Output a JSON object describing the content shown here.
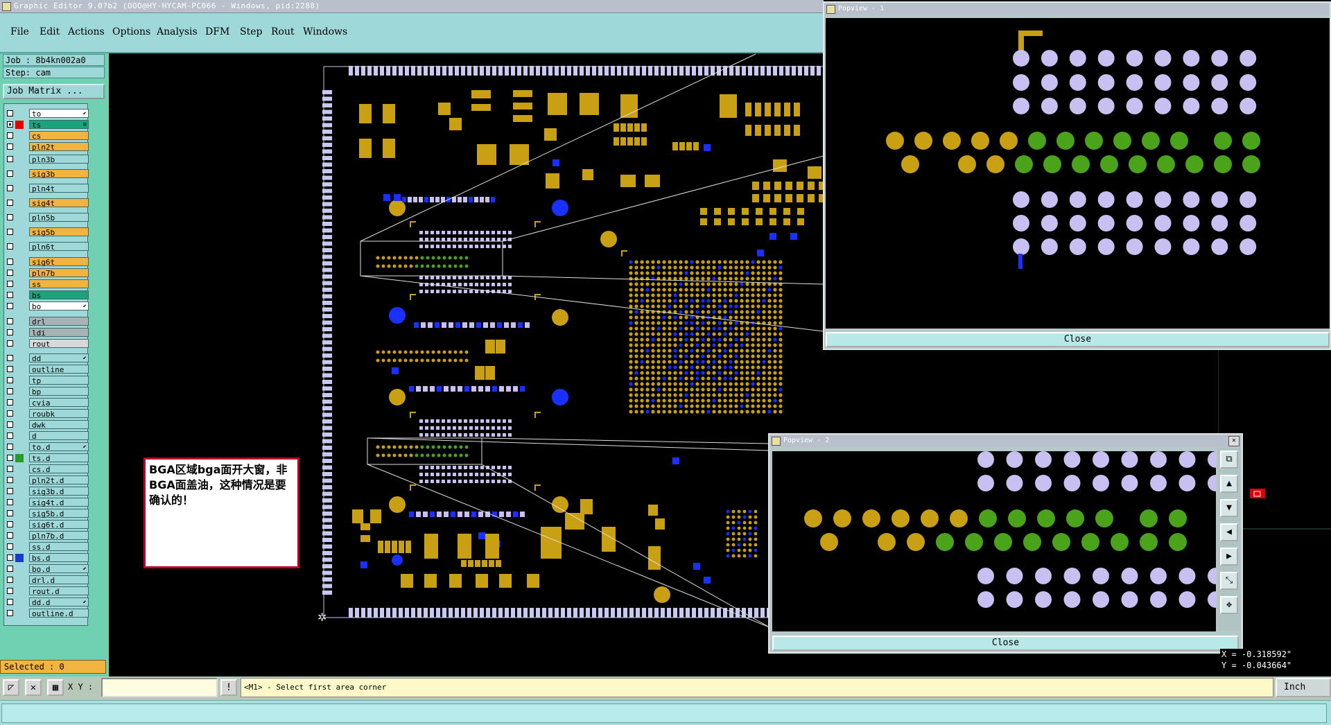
{
  "app": {
    "title": "Graphic Editor 9.0?b2 (OOO@HY-HYCAM-PC066 - Windows, pid:2288)"
  },
  "menu": [
    "File",
    "Edit",
    "Actions",
    "Options",
    "Analysis",
    "DFM",
    "Step",
    "Rout",
    "Windows"
  ],
  "job": {
    "job_line": "Job : 8b4kn002a0",
    "step_line": "Step: cam",
    "matrix_label": "Job Matrix ..."
  },
  "layers": [
    {
      "name": "to",
      "color": "#ffffff",
      "swatch": "",
      "mark": "⬋",
      "checked": false
    },
    {
      "name": "ts",
      "color": "#1aa37a",
      "swatch": "#e00000",
      "mark": "≡",
      "checked": true
    },
    {
      "name": "cs",
      "color": "#f2b441",
      "swatch": "",
      "mark": "",
      "checked": false
    },
    {
      "name": "pln2t",
      "color": "#f2b441",
      "swatch": "",
      "mark": "",
      "checked": false
    },
    {
      "name": "pln3b",
      "color": "#9fd8d8",
      "swatch": "",
      "mark": "",
      "checked": false
    },
    {
      "name": "sig3b",
      "color": "#f2b441",
      "swatch": "",
      "mark": "",
      "checked": false
    },
    {
      "name": "pln4t",
      "color": "#9fd8d8",
      "swatch": "",
      "mark": "",
      "checked": false
    },
    {
      "name": "sig4t",
      "color": "#f2b441",
      "swatch": "",
      "mark": "",
      "checked": false
    },
    {
      "name": "pln5b",
      "color": "#9fd8d8",
      "swatch": "",
      "mark": "",
      "checked": false
    },
    {
      "name": "sig5b",
      "color": "#f2b441",
      "swatch": "",
      "mark": "",
      "checked": false
    },
    {
      "name": "pln6t",
      "color": "#9fd8d8",
      "swatch": "",
      "mark": "",
      "checked": false
    },
    {
      "name": "sig6t",
      "color": "#f2b441",
      "swatch": "",
      "mark": "",
      "checked": false
    },
    {
      "name": "pln7b",
      "color": "#f2b441",
      "swatch": "",
      "mark": "",
      "checked": false
    },
    {
      "name": "ss",
      "color": "#f2b441",
      "swatch": "",
      "mark": "",
      "checked": false
    },
    {
      "name": "bs",
      "color": "#1aa37a",
      "swatch": "",
      "mark": "",
      "checked": false
    },
    {
      "name": "bo",
      "color": "#ffffff",
      "swatch": "",
      "mark": "⬋",
      "checked": false
    },
    {
      "name": "drl",
      "color": "#a8b4b4",
      "swatch": "",
      "mark": "",
      "checked": false
    },
    {
      "name": "ldi",
      "color": "#a8b4b4",
      "swatch": "",
      "mark": "",
      "checked": false
    },
    {
      "name": "rout",
      "color": "#d8d8d8",
      "swatch": "",
      "mark": "",
      "checked": false
    },
    {
      "name": "dd",
      "color": "#9fd8d8",
      "swatch": "",
      "mark": "⬋",
      "checked": false
    },
    {
      "name": "outline",
      "color": "#9fd8d8",
      "swatch": "",
      "mark": "",
      "checked": false
    },
    {
      "name": "tp",
      "color": "#9fd8d8",
      "swatch": "",
      "mark": "",
      "checked": false
    },
    {
      "name": "bp",
      "color": "#9fd8d8",
      "swatch": "",
      "mark": "",
      "checked": false
    },
    {
      "name": "cvia",
      "color": "#9fd8d8",
      "swatch": "",
      "mark": "",
      "checked": false
    },
    {
      "name": "roubk",
      "color": "#9fd8d8",
      "swatch": "",
      "mark": "",
      "checked": false
    },
    {
      "name": "dwk",
      "color": "#9fd8d8",
      "swatch": "",
      "mark": "",
      "checked": false
    },
    {
      "name": "d",
      "color": "#9fd8d8",
      "swatch": "",
      "mark": "",
      "checked": false
    },
    {
      "name": "to.d",
      "color": "#9fd8d8",
      "swatch": "",
      "mark": "⬋",
      "checked": false
    },
    {
      "name": "ts.d",
      "color": "#9fd8d8",
      "swatch": "#2a9a2a",
      "mark": "",
      "checked": false
    },
    {
      "name": "cs.d",
      "color": "#9fd8d8",
      "swatch": "",
      "mark": "",
      "checked": false
    },
    {
      "name": "pln2t.d",
      "color": "#9fd8d8",
      "swatch": "",
      "mark": "",
      "checked": false
    },
    {
      "name": "sig3b.d",
      "color": "#9fd8d8",
      "swatch": "",
      "mark": "",
      "checked": false
    },
    {
      "name": "sig4t.d",
      "color": "#9fd8d8",
      "swatch": "",
      "mark": "",
      "checked": false
    },
    {
      "name": "sig5b.d",
      "color": "#9fd8d8",
      "swatch": "",
      "mark": "",
      "checked": false
    },
    {
      "name": "sig6t.d",
      "color": "#9fd8d8",
      "swatch": "",
      "mark": "",
      "checked": false
    },
    {
      "name": "pln7b.d",
      "color": "#9fd8d8",
      "swatch": "",
      "mark": "",
      "checked": false
    },
    {
      "name": "ss.d",
      "color": "#9fd8d8",
      "swatch": "",
      "mark": "",
      "checked": false
    },
    {
      "name": "bs.d",
      "color": "#9fd8d8",
      "swatch": "#1a3ad0",
      "mark": "",
      "checked": false
    },
    {
      "name": "bo.d",
      "color": "#9fd8d8",
      "swatch": "",
      "mark": "⬋",
      "checked": false
    },
    {
      "name": "drl.d",
      "color": "#9fd8d8",
      "swatch": "",
      "mark": "",
      "checked": false
    },
    {
      "name": "rout.d",
      "color": "#9fd8d8",
      "swatch": "",
      "mark": "",
      "checked": false
    },
    {
      "name": "dd.d",
      "color": "#9fd8d8",
      "swatch": "",
      "mark": "⬋",
      "checked": false
    },
    {
      "name": "outline.d",
      "color": "#9fd8d8",
      "swatch": "",
      "mark": "",
      "checked": false
    }
  ],
  "selected": "Selected : 0",
  "note": "BGA区域bga面开大窗，非BGA面盖油，这种情况是要确认的！",
  "popup1": {
    "title": "Popview - 1",
    "close": "Close"
  },
  "popup2": {
    "title": "Popview - 2",
    "close": "Close"
  },
  "coords": {
    "x": "X = -0.318592\"",
    "y": "Y = -0.043664\""
  },
  "status": {
    "xy_label": "X Y :",
    "prompt": "<M1> - Select first area corner",
    "units": "Inch"
  },
  "colors": {
    "pad": "#c9a013",
    "pad_green": "#4aa31a",
    "pad_lav": "#c8c0f0",
    "via": "#1a30ff",
    "outline": "#c8c8f0"
  }
}
